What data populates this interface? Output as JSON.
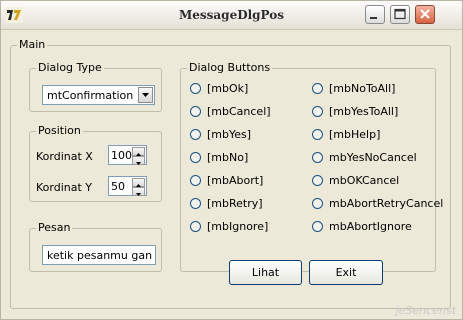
{
  "window": {
    "title": "MessageDlgPos",
    "controls": {
      "minimize": "minimize-icon",
      "maximize": "maximize-icon",
      "close": "close-icon"
    }
  },
  "main_group": {
    "label": "Main"
  },
  "dialog_type": {
    "label": "Dialog Type",
    "selected": "mtConfirmation"
  },
  "position": {
    "label": "Position",
    "x_label": "Kordinat X",
    "x_value": "100",
    "y_label": "Kordinat Y",
    "y_value": "50"
  },
  "pesan": {
    "label": "Pesan",
    "value": "ketik pesanmu gan"
  },
  "dialog_buttons": {
    "label": "Dialog Buttons",
    "left": [
      "[mbOk]",
      "[mbCancel]",
      "[mbYes]",
      "[mbNo]",
      "[mbAbort]",
      "[mbRetry]",
      "[mbIgnore]"
    ],
    "right": [
      "[mbNoToAll]",
      "[mbYesToAll]",
      "[mbHelp]",
      "mbYesNoCancel",
      "mbOKCancel",
      "mbAbortRetryCancel",
      "mbAbortIgnore"
    ]
  },
  "actions": {
    "lihat": "Lihat",
    "exit": "Exit"
  },
  "watermark": "jeSencenst"
}
